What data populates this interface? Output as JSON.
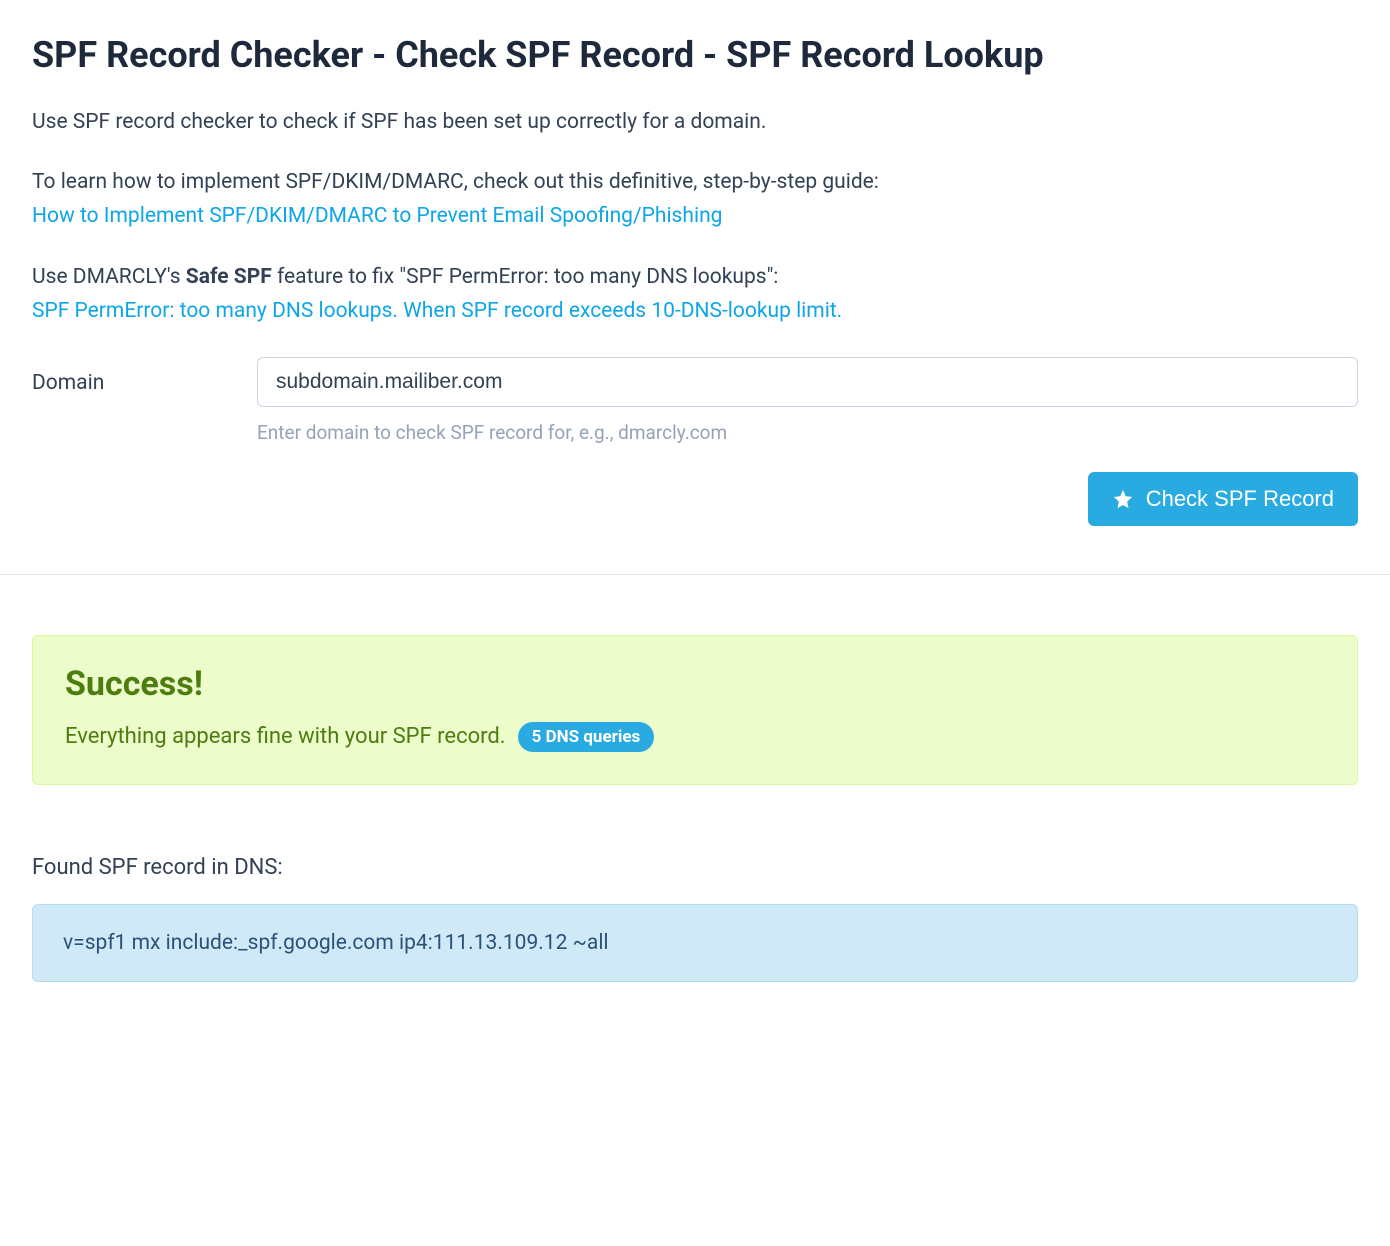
{
  "page": {
    "title": "SPF Record Checker - Check SPF Record - SPF Record Lookup",
    "intro1": "Use SPF record checker to check if SPF has been set up correctly for a domain.",
    "intro2_prefix": "To learn how to implement SPF/DKIM/DMARC, check out this definitive, step-by-step guide:",
    "intro2_link": "How to Implement SPF/DKIM/DMARC to Prevent Email Spoofing/Phishing",
    "intro3_prefix": "Use DMARCLY's ",
    "intro3_bold": "Safe SPF",
    "intro3_suffix": " feature to fix \"SPF PermError: too many DNS lookups\":",
    "intro3_link": "SPF PermError: too many DNS lookups. When SPF record exceeds 10-DNS-lookup limit."
  },
  "form": {
    "domain_label": "Domain",
    "domain_value": "subdomain.mailiber.com",
    "domain_help": "Enter domain to check SPF record for, e.g., dmarcly.com",
    "submit_label": "Check SPF Record"
  },
  "result": {
    "success_title": "Success!",
    "success_message": "Everything appears fine with your SPF record.",
    "dns_queries_badge": "5 DNS queries",
    "found_label": "Found SPF record in DNS:",
    "spf_record": "v=spf1 mx include:_spf.google.com ip4:111.13.109.12 ~all"
  }
}
